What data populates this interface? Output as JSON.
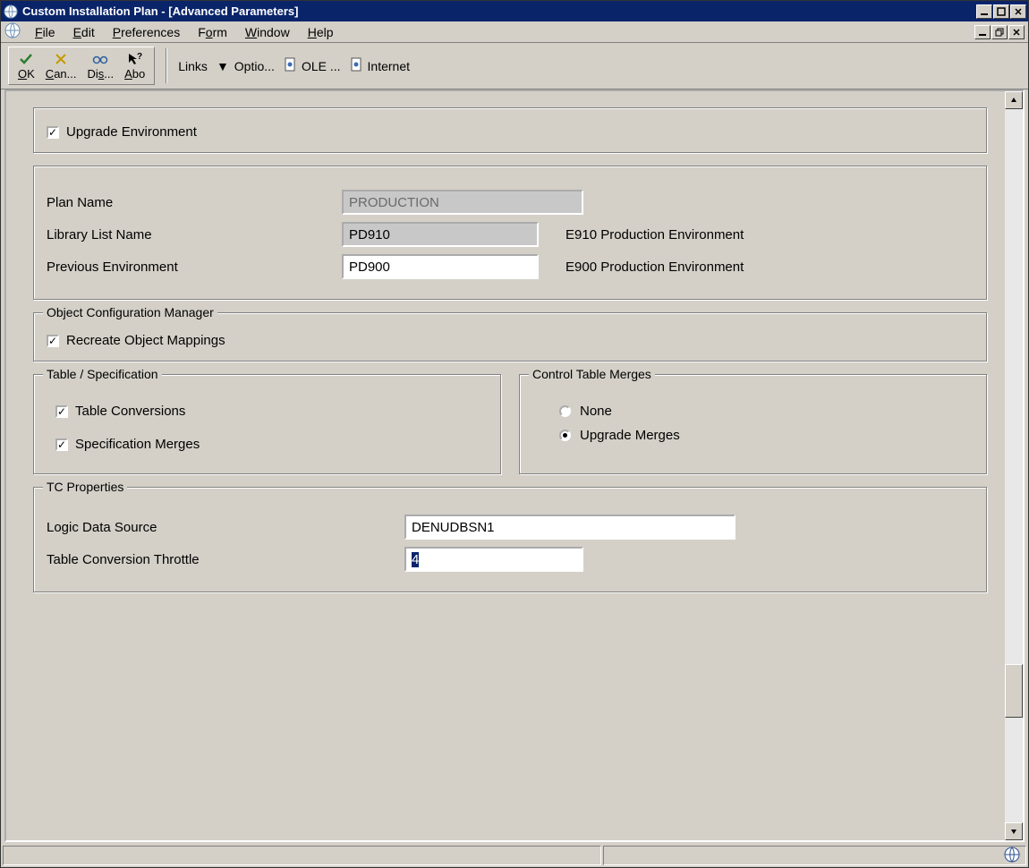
{
  "title": "Custom Installation Plan - [Advanced Parameters]",
  "menus": {
    "file": "File",
    "edit": "Edit",
    "preferences": "Preferences",
    "form": "Form",
    "window": "Window",
    "help": "Help"
  },
  "toolbar": {
    "ok": "OK",
    "cancel": "Can...",
    "display": "Dis...",
    "about": "Abo",
    "links": "Links",
    "optio": "Optio...",
    "ole": "OLE ...",
    "internet": "Internet"
  },
  "groups": {
    "upgrade_env_label": "Upgrade Environment",
    "plan_name_label": "Plan Name",
    "plan_name_value": "PRODUCTION",
    "library_list_label": "Library List Name",
    "library_list_value": "PD910",
    "library_list_desc": "E910 Production Environment",
    "prev_env_label": "Previous Environment",
    "prev_env_value": "PD900",
    "prev_env_desc": "E900 Production Environment",
    "ocm_legend": "Object Configuration Manager",
    "ocm_checkbox": "Recreate Object Mappings",
    "tspec_legend": "Table / Specification",
    "tspec_cb1": "Table Conversions",
    "tspec_cb2": "Specification Merges",
    "ctm_legend": "Control Table Merges",
    "ctm_r1": "None",
    "ctm_r2": "Upgrade Merges",
    "tcp_legend": "TC Properties",
    "tcp_lds_label": "Logic Data Source",
    "tcp_lds_value": "DENUDBSN1",
    "tcp_throttle_label": "Table Conversion Throttle",
    "tcp_throttle_value": "4"
  }
}
